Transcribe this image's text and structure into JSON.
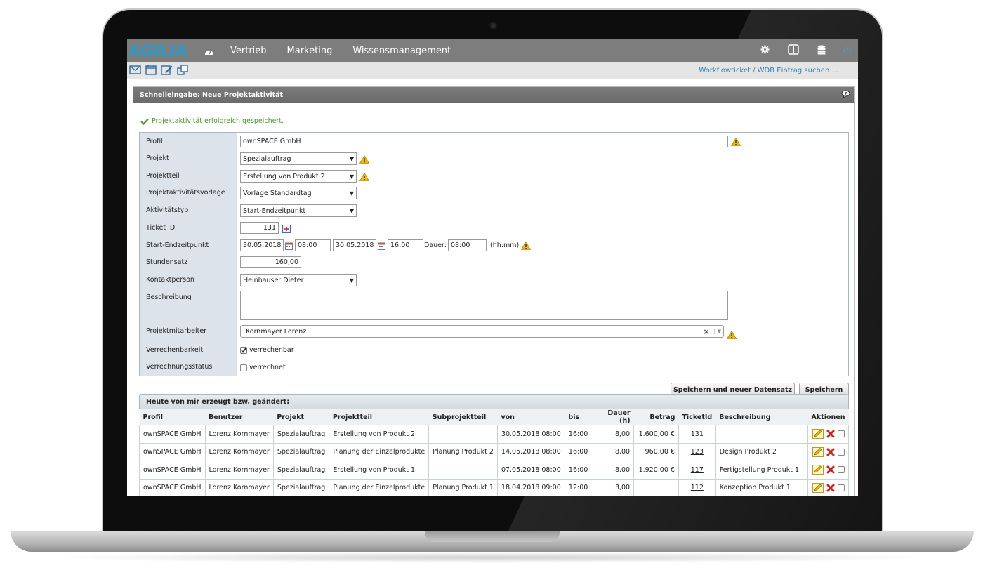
{
  "app": {
    "logo": "AGILIA"
  },
  "nav": {
    "items": [
      "Vertrieb",
      "Marketing",
      "Wissensmanagement"
    ],
    "power": "⏻"
  },
  "toolbar": {
    "workflow_link": "Workflowticket / WDB Eintrag suchen ..."
  },
  "panel": {
    "title": "Schnelleingabe: Neue Projektaktivität",
    "success": "Projektaktivität erfolgreich gespeichert."
  },
  "form": {
    "labels": {
      "profil": "Profil",
      "projekt": "Projekt",
      "projektteil": "Projektteil",
      "vorlage": "Projektaktivitätsvorlage",
      "typ": "Aktivitätstyp",
      "ticket": "Ticket ID",
      "zeit": "Start-Endzeitpunkt",
      "satz": "Stundensatz",
      "kontakt": "Kontaktperson",
      "beschreibung": "Beschreibung",
      "mitarbeiter": "Projektmitarbeiter",
      "verrechenbarkeit": "Verrechenbarkeit",
      "status": "Verrechnungsstatus"
    },
    "values": {
      "profil": "ownSPACE GmbH",
      "projekt": "Spezialauftrag",
      "projektteil": "Erstellung von Produkt 2",
      "vorlage": "Vorlage Standardtag",
      "typ": "Start-Endzeitpunkt",
      "ticket": "131",
      "start_date": "30.05.2018",
      "start_time": "08:00",
      "end_date": "30.05.2018",
      "end_time": "16:00",
      "dauer_label": "Dauer:",
      "dauer": "08:00",
      "dauer_unit": "(hh:mm)",
      "satz": "160,00",
      "kontakt": "Heinhauser Dieter",
      "beschreibung": "",
      "mitarbeiter": "Kornmayer Lorenz",
      "mitarbeiter_clear": "×",
      "verrechenbar": "verrechenbar",
      "verrechnet": "verrechnet"
    }
  },
  "buttons": {
    "save_new": "Speichern und neuer Datensatz",
    "save": "Speichern"
  },
  "recent": {
    "title": "Heute von mir erzeugt bzw. geändert:",
    "columns": [
      "Profil",
      "Benutzer",
      "Projekt",
      "Projektteil",
      "Subprojektteil",
      "von",
      "bis",
      "Dauer (h)",
      "Betrag",
      "TicketId",
      "Beschreibung",
      "Aktionen"
    ],
    "rows": [
      [
        "ownSPACE GmbH",
        "Lorenz Kornmayer",
        "Spezialauftrag",
        "Erstellung von Produkt 2",
        "",
        "30.05.2018 08:00",
        "16:00",
        "8,00",
        "1.600,00 €",
        "131",
        ""
      ],
      [
        "ownSPACE GmbH",
        "Lorenz Kornmayer",
        "Spezialauftrag",
        "Planung der Einzelprodukte",
        "Planung Produkt 2",
        "14.05.2018 08:00",
        "16:00",
        "8,00",
        "960,00 €",
        "123",
        "Design Produkt 2"
      ],
      [
        "ownSPACE GmbH",
        "Lorenz Kornmayer",
        "Spezialauftrag",
        "Erstellung von Produkt 1",
        "",
        "07.05.2018 08:00",
        "16:00",
        "8,00",
        "1.920,00 €",
        "117",
        "Fertigstellung Produkt 1"
      ],
      [
        "ownSPACE GmbH",
        "Lorenz Kornmayer",
        "Spezialauftrag",
        "Planung der Einzelprodukte",
        "Planung Produkt 1",
        "18.04.2018 09:00",
        "12:00",
        "3,00",
        "",
        "112",
        "Konzeption Produkt 1"
      ]
    ]
  },
  "colors": {
    "accent": "#1aa0d8",
    "nav_bg": "#7d7d7d",
    "success": "#4a9a2a",
    "warning": "#f2b705"
  }
}
